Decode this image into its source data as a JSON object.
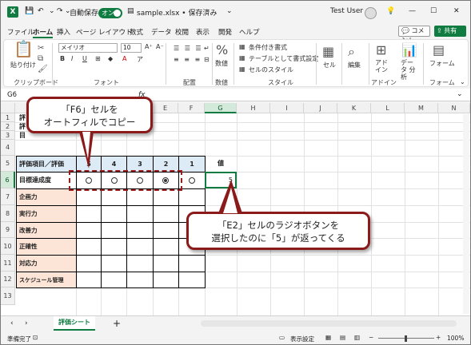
{
  "titlebar": {
    "logo": "X",
    "autosave_label": "自動保存",
    "autosave_state": "オン",
    "file_name": "sample.xlsx • 保存済み",
    "user": "Test User"
  },
  "menu": [
    "ファイル",
    "ホーム",
    "挿入",
    "ページ レイアウト",
    "数式",
    "データ",
    "校閲",
    "表示",
    "開発",
    "ヘルプ"
  ],
  "menu_active": "ホーム",
  "menu_buttons": {
    "comment": "コメント",
    "share": "共有"
  },
  "ribbon": {
    "clipboard": {
      "paste": "貼り付け",
      "label": "クリップボード"
    },
    "font": {
      "name": "メイリオ",
      "size": "10",
      "label": "フォント"
    },
    "align": {
      "label": "配置"
    },
    "number": {
      "btn": "数値",
      "label": "数値"
    },
    "styles": {
      "conditional": "条件付き書式",
      "table": "テーブルとして書式設定",
      "cell_style": "セルのスタイル",
      "label": "スタイル"
    },
    "cells": {
      "btn": "セル"
    },
    "edit": {
      "btn": "編集"
    },
    "addin": {
      "btn": "アド イン",
      "label": "アドイン"
    },
    "analyze": {
      "btn": "データ 分析"
    },
    "form": {
      "btn": "フォーム",
      "label": "フォーム"
    }
  },
  "formula_bar": {
    "name_box": "G6",
    "fx": "fx",
    "value": "5"
  },
  "columns": [
    "A",
    "B",
    "C",
    "D",
    "E",
    "F",
    "G",
    "H",
    "I",
    "J",
    "K",
    "L",
    "M",
    "N"
  ],
  "selected_column": "G",
  "rows": [
    "1",
    "2",
    "3",
    "4",
    "5",
    "6",
    "7",
    "8",
    "9",
    "10",
    "11",
    "12",
    "13"
  ],
  "selected_row": "6",
  "sheet": {
    "row5_label": "評価項目／評価",
    "scores": [
      "5",
      "4",
      "3",
      "2",
      "1"
    ],
    "value_header": "値",
    "row6_label": "目標達成度",
    "g6_value": "5",
    "radio_selected_index": 3,
    "items": [
      "企画力",
      "実行力",
      "改善力",
      "正確性",
      "対応力",
      "スケジュール管理"
    ],
    "partial_rows": [
      "評",
      "評",
      "目"
    ]
  },
  "sheet_tab": "評価シート",
  "status": {
    "ready": "準備完了",
    "display_settings": "表示設定",
    "zoom": "100%"
  },
  "callouts": {
    "top": [
      "「F6」セルを",
      "オートフィルでコピー"
    ],
    "bottom": [
      "「E2」セルのラジオボタンを",
      "選択したのに「5」が返ってくる"
    ]
  },
  "colors": {
    "accent": "#107c41",
    "callout_border": "#8b1a1a",
    "header_fill": "#ddebf7",
    "label_fill": "#fce4d6"
  }
}
